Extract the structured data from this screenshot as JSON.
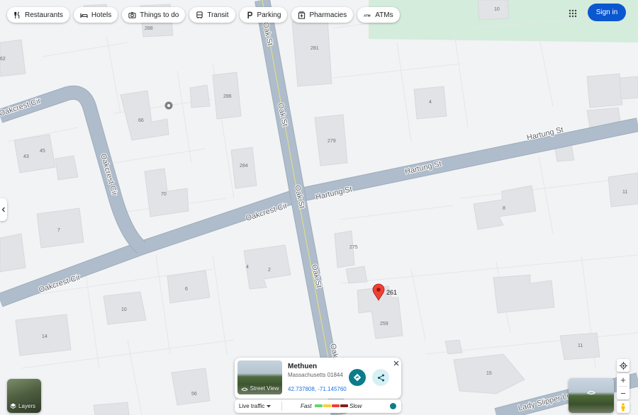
{
  "categories": [
    {
      "label": "Restaurants",
      "icon": "restaurant-icon"
    },
    {
      "label": "Hotels",
      "icon": "bed-icon"
    },
    {
      "label": "Things to do",
      "icon": "camera-icon"
    },
    {
      "label": "Transit",
      "icon": "bus-icon"
    },
    {
      "label": "Parking",
      "icon": "parking-icon"
    },
    {
      "label": "Pharmacies",
      "icon": "pharmacy-icon"
    },
    {
      "label": "ATMs",
      "icon": "atm-icon"
    }
  ],
  "header": {
    "signin_label": "Sign in",
    "apps_icon": "apps-grid-icon"
  },
  "streets": {
    "oak_st": "Oak St",
    "oakcrest_cir": "Oakcrest Cir",
    "hartung_st": "Hartung St",
    "lady_slipper_ln": "Lady Slipper Ln"
  },
  "house_numbers": {
    "h10": "10",
    "h288": "288",
    "h281": "281",
    "h62": "62",
    "h286": "286",
    "h4": "4",
    "h66": "66",
    "h279": "279",
    "h43": "43",
    "h45": "45",
    "h284": "284",
    "h70": "70",
    "h11": "11",
    "h8": "8",
    "h7": "7",
    "h275": "275",
    "h4b": "4",
    "h2": "2",
    "h6": "6",
    "h10b": "10",
    "h259": "259",
    "h14": "14",
    "h11b": "11",
    "h15": "15",
    "h56": "56"
  },
  "marker": {
    "label": "261",
    "color": "#ea4335"
  },
  "place_card": {
    "title": "Methuen",
    "subtitle": "Massachusetts 01844",
    "coords": "42.737808, -71.145760",
    "street_view_label": "Street View",
    "directions_icon": "directions-icon",
    "share_icon": "share-icon",
    "close_icon": "close-icon"
  },
  "traffic": {
    "select_label": "Live traffic",
    "fast_label": "Fast",
    "slow_label": "Slow",
    "scale_colors": [
      "#63d668",
      "#ffcb40",
      "#f23c32",
      "#811f1f"
    ],
    "toggle_color": "#0b7d8a"
  },
  "layers": {
    "label": "Layers"
  },
  "controls": {
    "zoom_in": "+",
    "zoom_out": "−",
    "locate_icon": "my-location-icon",
    "pegman_icon": "pegman-icon"
  },
  "colors": {
    "road": "#aebccb",
    "road_edge": "#9eacbb",
    "building": "#e1e3e6",
    "background": "#f2f3f5",
    "park": "#cfe9d6",
    "brand": "#0b57d0"
  }
}
